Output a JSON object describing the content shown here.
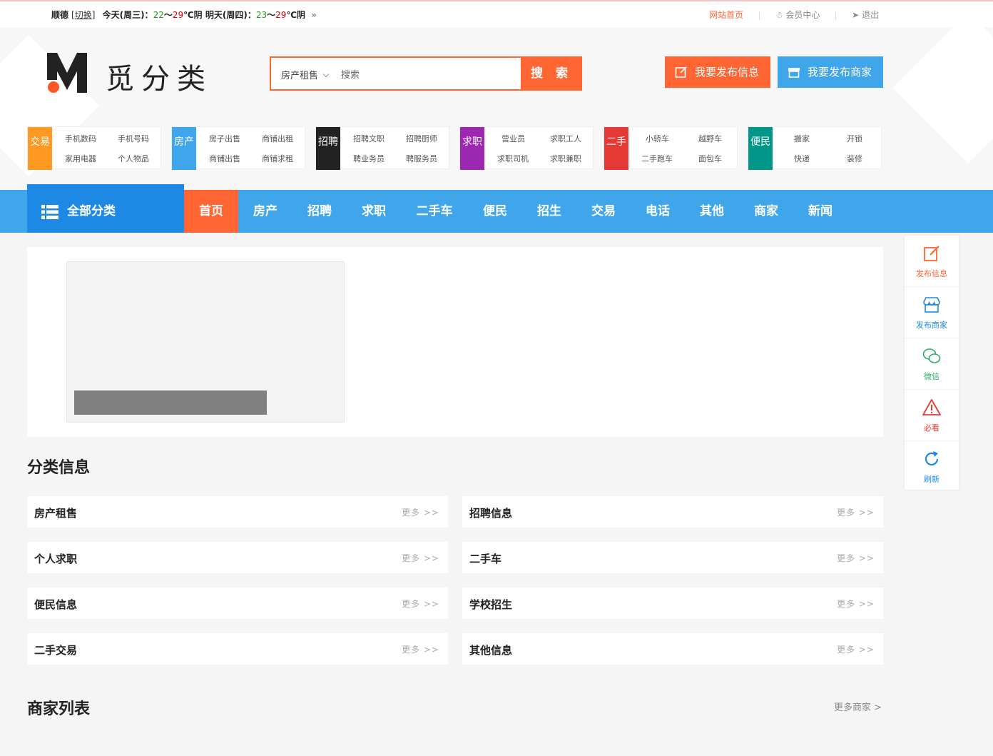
{
  "topbar": {
    "city": "顺德",
    "switch_label": "[切换]",
    "weather_today_label": "今天(周三)：",
    "weather_today_low": "22",
    "weather_today_sep": "～",
    "weather_today_high": "29",
    "weather_today_desc": "℃阴",
    "weather_tomorrow_label": "明天(周四)：",
    "weather_tomorrow_low": "23",
    "weather_tomorrow_sep": "～",
    "weather_tomorrow_high": "29",
    "weather_tomorrow_desc": "℃阴",
    "more_arrow": "»",
    "home_link": "网站首页",
    "member_link": "会员中心",
    "logout_link": "退出"
  },
  "logo": {
    "text": "觅分类"
  },
  "search": {
    "category": "房产租售",
    "placeholder": "搜索",
    "button": "搜 索"
  },
  "publish": {
    "info_button": "我要发布信息",
    "shop_button": "我要发布商家"
  },
  "category_blocks": [
    {
      "tag": "交易",
      "color": "#ff9922",
      "links": [
        "手机数码",
        "手机号码",
        "家用电器",
        "个人物品"
      ]
    },
    {
      "tag": "房产",
      "color": "#3fa6ec",
      "links": [
        "房子出售",
        "商铺出租",
        "商铺出售",
        "商铺求租"
      ]
    },
    {
      "tag": "招聘",
      "color": "#222222",
      "links": [
        "招聘文职",
        "招聘厨师",
        "聘业务员",
        "聘服务员"
      ]
    },
    {
      "tag": "求职",
      "color": "#9c27b0",
      "links": [
        "营业员",
        "求职工人",
        "求职司机",
        "求职兼职"
      ]
    },
    {
      "tag": "二手",
      "color": "#e53935",
      "links": [
        "小轿车",
        "越野车",
        "二手跑车",
        "面包车"
      ]
    },
    {
      "tag": "便民",
      "color": "#009688",
      "links": [
        "搬家",
        "开锁",
        "快递",
        "装修"
      ]
    }
  ],
  "nav": {
    "all_label": "全部分类",
    "items": [
      "首页",
      "房产",
      "招聘",
      "求职",
      "二手车",
      "便民",
      "招生",
      "交易",
      "电话",
      "其他",
      "商家",
      "新闻"
    ]
  },
  "section_info_title": "分类信息",
  "info_rows": [
    {
      "name": "房产租售",
      "more": "更多 >>"
    },
    {
      "name": "招聘信息",
      "more": "更多 >>"
    },
    {
      "name": "个人求职",
      "more": "更多 >>"
    },
    {
      "name": "二手车",
      "more": "更多 >>"
    },
    {
      "name": "便民信息",
      "more": "更多 >>"
    },
    {
      "name": "学校招生",
      "more": "更多 >>"
    },
    {
      "name": "二手交易",
      "more": "更多 >>"
    },
    {
      "name": "其他信息",
      "more": "更多 >>"
    }
  ],
  "section_shop_title": "商家列表",
  "more_shops": "更多商家 >",
  "side_toolbar": [
    {
      "label": "发布信息",
      "icon": "edit-icon",
      "color": "#ff6633"
    },
    {
      "label": "发布商家",
      "icon": "shop-icon",
      "color": "#1e88e5"
    },
    {
      "label": "微信",
      "icon": "wechat-icon",
      "color": "#2aae67"
    },
    {
      "label": "必看",
      "icon": "warning-icon",
      "color": "#e53935"
    },
    {
      "label": "刷新",
      "icon": "refresh-icon",
      "color": "#1e88e5"
    }
  ]
}
